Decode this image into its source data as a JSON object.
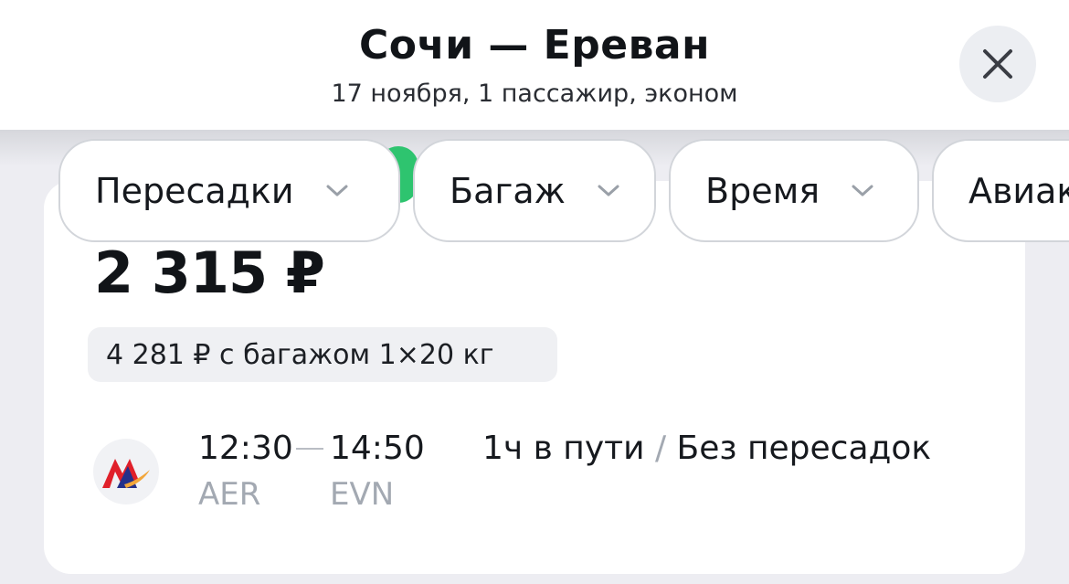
{
  "header": {
    "route": "Сочи — Ереван",
    "subtitle": "17 ноября, 1 пассажир, эконом"
  },
  "filters": [
    {
      "label": "Пересадки"
    },
    {
      "label": "Багаж"
    },
    {
      "label": "Время"
    },
    {
      "label": "Авиакомпании"
    }
  ],
  "ticket": {
    "price": "2 315 ₽",
    "baggage_offer": "4 281 ₽ с багажом 1×20 кг",
    "departure_time": "12:30",
    "arrival_time": "14:50",
    "departure_code": "AER",
    "arrival_code": "EVN",
    "duration": "1ч в пути",
    "separator": "/",
    "stops": "Без пересадок",
    "airline_logo_icon": "airline-logo-icon"
  },
  "colors": {
    "green_badge": "#2ec46f",
    "logo_red": "#e0202a",
    "logo_blue": "#24308a",
    "logo_orange": "#f2a63a"
  }
}
